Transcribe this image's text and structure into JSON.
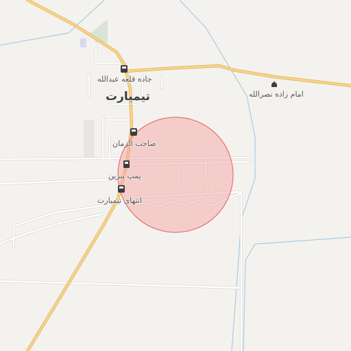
{
  "map": {
    "background": "#f4f2ee",
    "road_major_color": "#f2c46d",
    "road_minor_color": "#ffffff",
    "river_color": "#9cc3e6",
    "highlight_fill": "#f4a0a0",
    "highlight_stroke": "#e97070"
  },
  "labels": {
    "town": "تیمیارت",
    "stop_abdollah": "جاده قلعه عبدالله",
    "stop_saheb": "صاحب الزمان",
    "fuel_station": "پمپ بنزین",
    "stop_end": "انتهای تیمیارت",
    "shrine": "امام زاده نصرالله"
  },
  "icons": {
    "bus_stop": "bus-stop-icon",
    "fuel": "fuel-pump-icon",
    "shrine": "shrine-icon"
  }
}
